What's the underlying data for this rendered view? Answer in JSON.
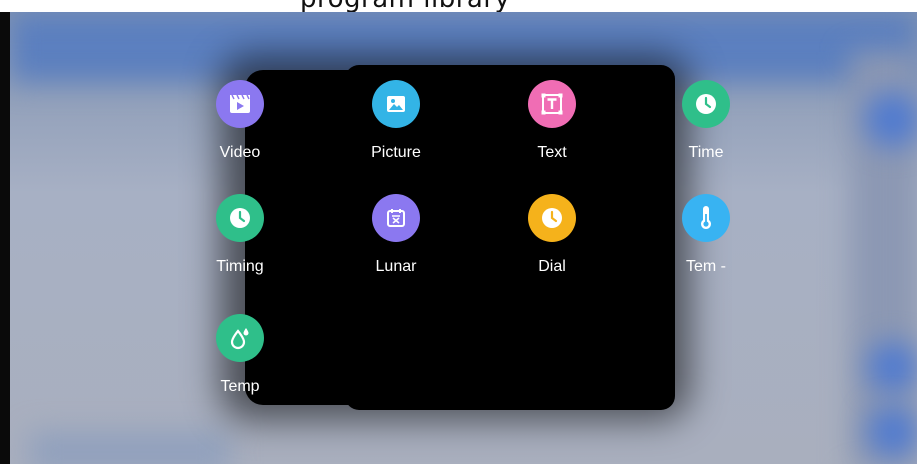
{
  "header": {
    "partial_text": "program library"
  },
  "popup": {
    "items": [
      {
        "label": "Video",
        "icon": "video-icon",
        "color": "#8b78f0"
      },
      {
        "label": "Picture",
        "icon": "picture-icon",
        "color": "#33b4e6"
      },
      {
        "label": "Text",
        "icon": "text-icon",
        "color": "#f06db4"
      },
      {
        "label": "Time",
        "icon": "clock-icon",
        "color": "#2fbf8a"
      },
      {
        "label": "Timing",
        "icon": "clock-icon",
        "color": "#2fbf8a"
      },
      {
        "label": "Lunar",
        "icon": "calendar-icon",
        "color": "#8b78f0"
      },
      {
        "label": "Dial",
        "icon": "clock-icon",
        "color": "#f5b21b"
      },
      {
        "label": "Tem -",
        "icon": "thermometer-icon",
        "color": "#38b3f2"
      },
      {
        "label": "Temp",
        "icon": "humidity-icon",
        "color": "#2fbf8a"
      }
    ]
  }
}
